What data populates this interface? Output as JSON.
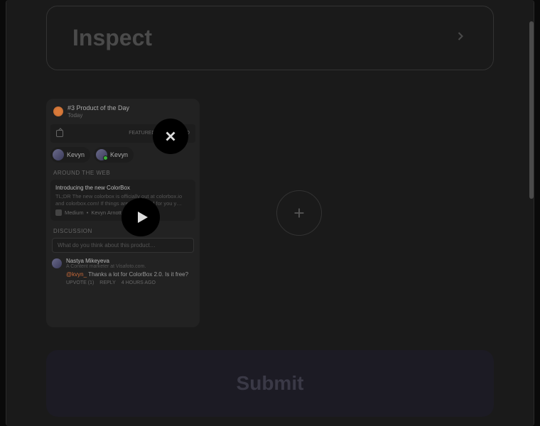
{
  "inspect": {
    "title": "Inspect"
  },
  "submit": {
    "label": "Submit"
  },
  "card": {
    "badge_title": "#3 Product of the Day",
    "badge_sub": "Today",
    "featured": "FEATURED 5 YEARS AGO",
    "makers": [
      {
        "name": "Kevyn"
      },
      {
        "name": "Kevyn"
      }
    ],
    "around_label": "AROUND THE WEB",
    "web": {
      "title": "Introducing the new ColorBox",
      "desc": "TL;DR The new colorbox is officially out at colorbox.io and colorbox.com! If things aren't updated for you y…",
      "source": "Medium",
      "author": "Kevyn Arnott"
    },
    "discussion_label": "DISCUSSION",
    "input_placeholder": "What do you think about this product…",
    "comment": {
      "name": "Nastya Mikeyeva",
      "role": "A Content marketer at Visafoto.com.",
      "mention": "@kvyn_",
      "text": "Thanks a lot for ColorBox 2.0. Is it free?",
      "upvote": "UPVOTE (1)",
      "reply": "REPLY",
      "time": "4 HOURS AGO"
    }
  }
}
